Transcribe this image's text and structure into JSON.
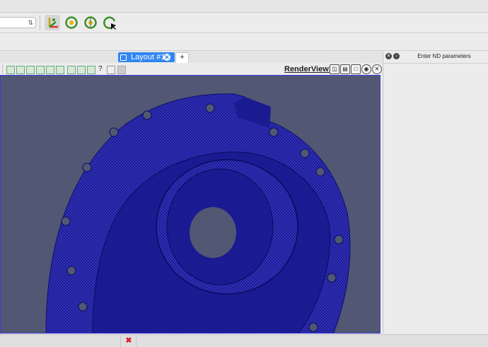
{
  "toolbar": {
    "combo_value": "",
    "icons": [
      "axes-orient-icon",
      "reset-camera-icon",
      "rotate-center-icon",
      "reset-rotation-icon"
    ]
  },
  "tabs": {
    "layout_label": "Layout #1",
    "add_label": "+"
  },
  "view": {
    "title": "RenderView1",
    "toolbar_icons": [
      "select-points-icon",
      "select-cells-icon",
      "frustum-icon",
      "select-block-icon",
      "interactive-select-icon",
      "hover-points-icon",
      "hover-cells-icon",
      "grow-icon",
      "shrink-icon",
      "query-icon",
      "clear-selection-icon",
      "edit-icon"
    ],
    "buttons": [
      "split-horizontal-icon",
      "split-vertical-icon",
      "maximize-icon",
      "undock-icon",
      "close-view-icon"
    ]
  },
  "panel": {
    "title": "Enter ND parameters"
  },
  "colors": {
    "render_bg": "#525773",
    "mesh": "#1a1a9a",
    "tab_active": "#2f86f4"
  }
}
